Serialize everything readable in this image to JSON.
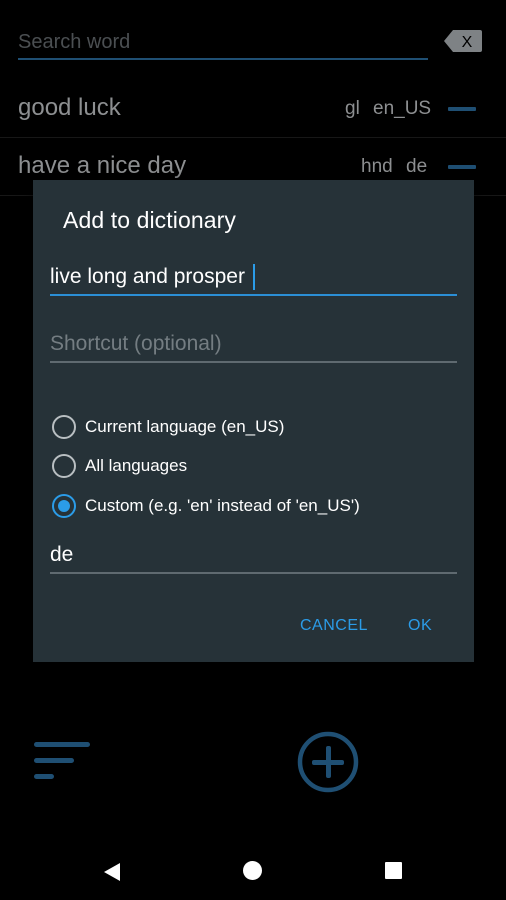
{
  "search": {
    "placeholder": "Search word",
    "clear_label": "X"
  },
  "words": [
    {
      "word": "good luck",
      "shortcut": "gl",
      "language": "en_US"
    },
    {
      "word": "have a nice day",
      "shortcut": "hnd",
      "language": "de"
    }
  ],
  "dialog": {
    "title": "Add to dictionary",
    "word_value": "live long and prosper",
    "shortcut_placeholder": "Shortcut (optional)",
    "options": [
      {
        "label": "Current language (en_US)",
        "checked": false
      },
      {
        "label": "All languages",
        "checked": false
      },
      {
        "label": "Custom (e.g. 'en' instead of 'en_US')",
        "checked": true
      }
    ],
    "custom_value": "de",
    "cancel_label": "CANCEL",
    "ok_label": "OK"
  },
  "colors": {
    "accent": "#2b9ce8",
    "dialog_bg": "#263238",
    "dim_accent": "#1f4f73",
    "background": "#000000"
  },
  "icons": {
    "clear": "backspace-x-icon",
    "remove": "minus-icon",
    "sort": "sort-icon",
    "add": "plus-circle-icon",
    "back": "back-triangle-icon",
    "home": "home-circle-icon",
    "recents": "recents-square-icon"
  }
}
